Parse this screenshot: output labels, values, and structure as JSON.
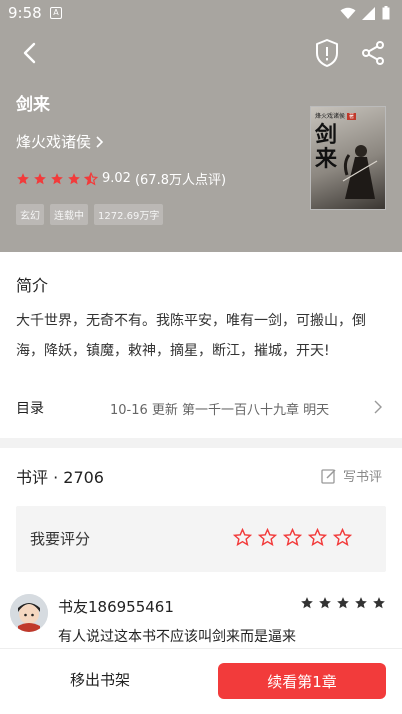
{
  "status_bar": {
    "time": "9:58",
    "notif_badge": "A"
  },
  "header": {
    "back_icon": "back-arrow-icon",
    "report_icon": "shield-alert-icon",
    "share_icon": "share-icon"
  },
  "book": {
    "title": "剑来",
    "author": "烽火戏诸侯",
    "rating_stars": 4.5,
    "score": "9.02",
    "review_count": "(67.8万人点评)",
    "tags": [
      "玄幻",
      "连载中",
      "1272.69万字"
    ],
    "cover_title": "剑来",
    "cover_author": "烽火戏诸侯",
    "cover_badge": "著"
  },
  "intro": {
    "heading": "简介",
    "text": "大千世界，无奇不有。我陈平安，唯有一剑，可搬山，倒海，降妖，镇魔，敕神，摘星，断江，摧城，开天!"
  },
  "catalog": {
    "label": "目录",
    "info": "10-16  更新  第一千一百八十九章 明天"
  },
  "reviews": {
    "heading": "书评 · 2706",
    "write_label": "写书评",
    "rate_label": "我要评分",
    "comment": {
      "user": "书友186955461",
      "stars": 5,
      "text": "有人说过这本书不应该叫剑来而是逼来"
    }
  },
  "bottom_bar": {
    "remove_label": "移出书架",
    "read_label": "续看第1章"
  },
  "colors": {
    "accent": "#f23b3b",
    "hero_bg": "#a8a5a0"
  }
}
